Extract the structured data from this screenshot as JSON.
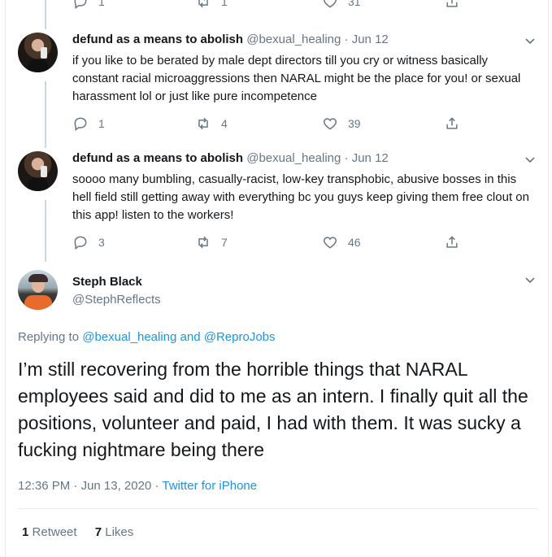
{
  "top_actions": {
    "replies": "1",
    "retweets": "1",
    "likes": "31"
  },
  "replies": [
    {
      "display_name": "defund as a means to abolish",
      "handle": "@bexual_healing",
      "separator": "·",
      "date": "Jun 12",
      "text": "if you like to be berated by male dept directors till you cry or witness basically constant racial microaggressions then NARAL might be the place for you! or sexual harassment lol or just like pure incompetence",
      "replies": "1",
      "retweets": "4",
      "likes": "39"
    },
    {
      "display_name": "defund as a means to abolish",
      "handle": "@bexual_healing",
      "separator": "·",
      "date": "Jun 12",
      "text": "soooo many bumbling, casually-racist, low-key transphobic, abusive bosses in this hell field still getting away with everything bc you guys keep giving them free clout on this app! listen to the workers!",
      "replies": "3",
      "retweets": "7",
      "likes": "46"
    }
  ],
  "focus_tweet": {
    "display_name": "Steph Black",
    "handle": "@StephReflects",
    "replying_prefix": "Replying to",
    "replying_user1": "@bexual_healing",
    "replying_and": "and",
    "replying_user2": "@ReproJobs",
    "text": "I’m still recovering from the horrible things that NARAL employees said and did to me as an intern. I finally quit all the positions, volunteer and paid, I had with them. It was sucky a fucking nightmare being there",
    "time": "12:36 PM",
    "separator1": "·",
    "date": "Jun 13, 2020",
    "separator2": "·",
    "source": "Twitter for iPhone",
    "retweet_count": "1",
    "retweet_label": "Retweet",
    "like_count": "7",
    "like_label": "Likes"
  },
  "icons": {
    "reply": "reply-icon",
    "retweet": "retweet-icon",
    "like": "heart-icon",
    "share": "share-icon",
    "caret": "chevron-down-icon"
  },
  "colors": {
    "text": "#14171a",
    "muted": "#657786",
    "link": "#1b95e0",
    "border": "#e6ecf0"
  }
}
